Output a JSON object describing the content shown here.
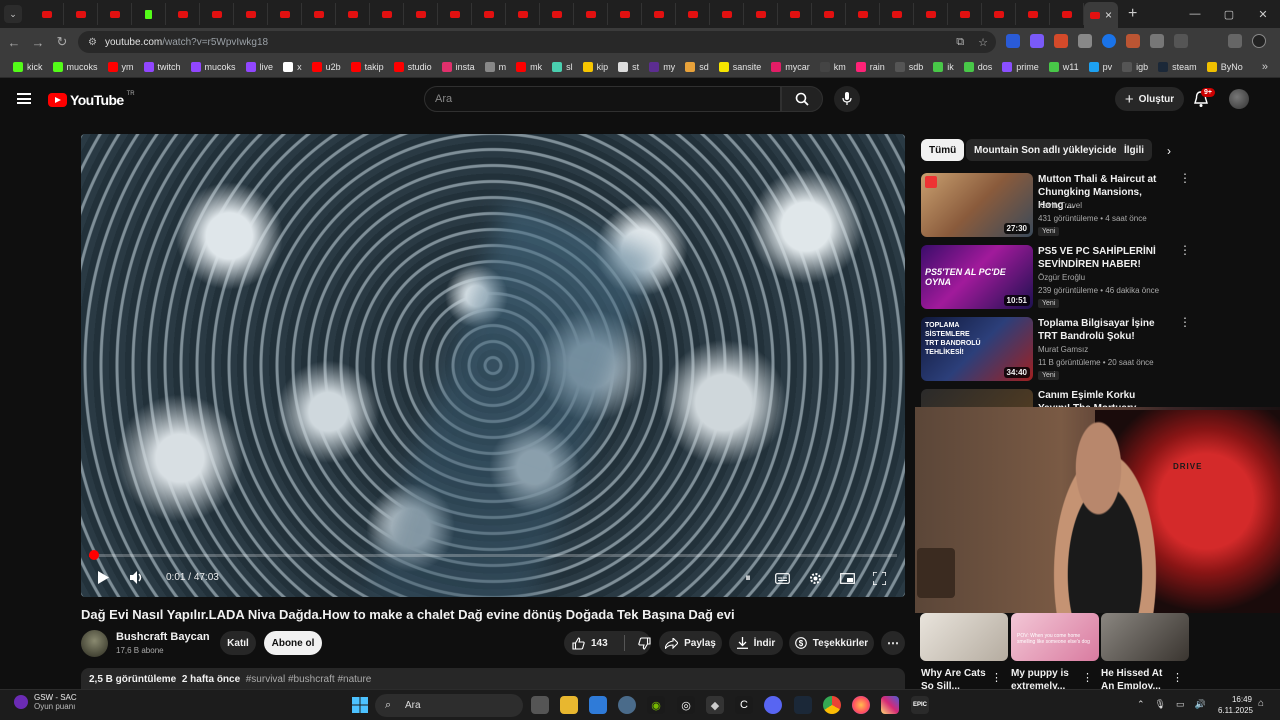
{
  "browser": {
    "active_tab_close": "×",
    "new_tab": "+",
    "window": {
      "minimize": "—",
      "maximize": "▢",
      "close": "✕"
    },
    "url_host": "youtube.com",
    "url_path": "/watch?v=r5WpvIwkg18",
    "bookmarks": [
      {
        "label": "kick",
        "color": "#53fc18"
      },
      {
        "label": "mucoks",
        "color": "#53fc18"
      },
      {
        "label": "ym",
        "color": "#ff0000"
      },
      {
        "label": "twitch",
        "color": "#9146ff"
      },
      {
        "label": "mucoks",
        "color": "#9146ff"
      },
      {
        "label": "live",
        "color": "#9146ff"
      },
      {
        "label": "x",
        "color": "#ffffff"
      },
      {
        "label": "u2b",
        "color": "#ff0000"
      },
      {
        "label": "takip",
        "color": "#ff0000"
      },
      {
        "label": "studio",
        "color": "#ff0000"
      },
      {
        "label": "insta",
        "color": "#e1306c"
      },
      {
        "label": "m",
        "color": "#888888"
      },
      {
        "label": "mk",
        "color": "#ff0000"
      },
      {
        "label": "sl",
        "color": "#4ad0b0"
      },
      {
        "label": "kip",
        "color": "#f7c600"
      },
      {
        "label": "st",
        "color": "#dddddd"
      },
      {
        "label": "my",
        "color": "#5c2d91"
      },
      {
        "label": "sd",
        "color": "#e8a23a"
      },
      {
        "label": "sansite",
        "color": "#f7e600"
      },
      {
        "label": "mycar",
        "color": "#e21d66"
      },
      {
        "label": "km",
        "color": "#444444"
      },
      {
        "label": "rain",
        "color": "#ff2277"
      },
      {
        "label": "sdb",
        "color": "#555555"
      },
      {
        "label": "ik",
        "color": "#48c848"
      },
      {
        "label": "dos",
        "color": "#48c848"
      },
      {
        "label": "prime",
        "color": "#8a4fff"
      },
      {
        "label": "w11",
        "color": "#48c848"
      },
      {
        "label": "pv",
        "color": "#1da1f2"
      },
      {
        "label": "igb",
        "color": "#555555"
      },
      {
        "label": "steam",
        "color": "#1b2838"
      },
      {
        "label": "ByNo",
        "color": "#f0c000"
      }
    ]
  },
  "youtube": {
    "logo_text": "YouTube",
    "logo_country": "TR",
    "search_placeholder": "Ara",
    "create_label": "Oluştur",
    "notification_badge": "9+"
  },
  "player": {
    "current_time": "0:01",
    "duration": "47:03",
    "progress_fraction": 0.001
  },
  "video": {
    "title": "Dağ Evi Nasıl Yapılır.LADA Niva Dağda.How to make a chalet Dağ evine dönüş Doğada Tek Başına Dağ evi",
    "channel_name": "Bushcraft Baycan",
    "subscribers": "17,6 B abone",
    "join_label": "Katıl",
    "subscribe_label": "Abone ol",
    "likes": "143",
    "share_label": "Paylaş",
    "download_label": "İndir",
    "thanks_label": "Teşekkürler",
    "views": "2,5 B görüntüleme",
    "age": "2 hafta önce",
    "tags": "#survival #bushcraft #nature"
  },
  "sidebar": {
    "chips": [
      "Tümü",
      "Mountain Son adlı yükleyiciden",
      "İlgili"
    ],
    "recommendations": [
      {
        "title": "Mutton Thali & Haircut at Chungking Mansions, Hong ...",
        "channel": "Kevin Travel",
        "meta": "431 görüntüleme • 4 saat önce",
        "badge": "Yeni",
        "duration": "27:30"
      },
      {
        "title": "PS5 VE PC SAHİPLERİNİ SEVİNDİREN HABER!",
        "channel": "Özgür Eroğlu",
        "meta": "239 görüntüleme • 46 dakika önce",
        "badge": "Yeni",
        "duration": "10:51",
        "thumb_text": "PS5'TEN AL PC'DE OYNA"
      },
      {
        "title": "Toplama Bilgisayar İşine TRT Bandrolü Şoku!",
        "channel": "Murat Gamsız",
        "meta": "11 B görüntüleme • 20 saat önce",
        "badge": "Yeni",
        "duration": "34:40",
        "thumb_text": "TOPLAMA SİSTEMLERE TRT BANDROLÜ TEHLİKESİ!"
      },
      {
        "title": "Canım Eşimle Korku Yayını! The Mortuary Assistant Oynuyor..."
      }
    ],
    "shorts": [
      {
        "title": "Why Are Cats So Sill..."
      },
      {
        "title": "My puppy is extremely..."
      },
      {
        "title": "He Hissed At An Employ..."
      }
    ],
    "short_caption": "POV: When you come home smelling like someone else's dog"
  },
  "webcam": {
    "chair_brand": "DRIVE"
  },
  "taskbar": {
    "weather_title": "GSW - SAC",
    "weather_sub": "Oyun puanı",
    "search_label": "Ara",
    "time": "16:49",
    "date": "6.11.2025"
  }
}
